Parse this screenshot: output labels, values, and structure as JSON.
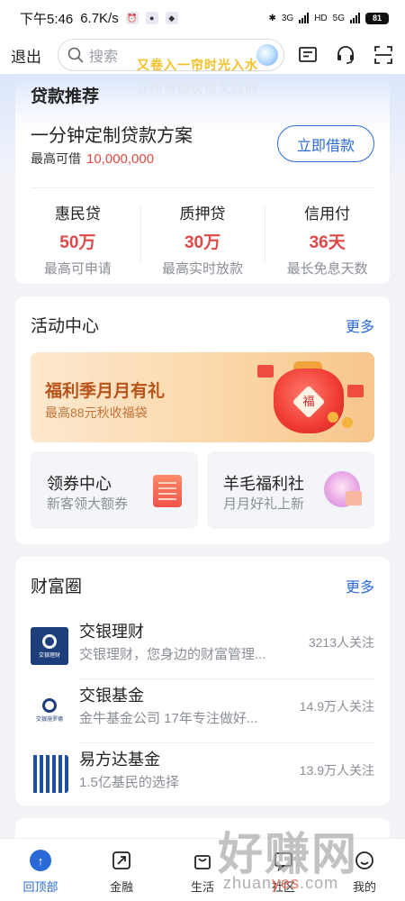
{
  "status_bar": {
    "time": "下午5:46",
    "speed": "6.7K/s",
    "net1": "3G",
    "net2": "5G",
    "hd": "HD",
    "battery": "81"
  },
  "header": {
    "logout": "退出",
    "search_placeholder": "搜索"
  },
  "overlay": {
    "line1": "又卷入一帘时光入水",
    "line2": "让所有很久很久以前"
  },
  "loan": {
    "title": "贷款推荐",
    "headline": "一分钟定制贷款方案",
    "limit_label": "最高可借",
    "limit_value": "10,000,000",
    "button": "立即借款",
    "products": [
      {
        "name": "惠民贷",
        "value": "50万",
        "sub": "最高可申请"
      },
      {
        "name": "质押贷",
        "value": "30万",
        "sub": "最高实时放款"
      },
      {
        "name": "信用付",
        "value": "36天",
        "sub": "最长免息天数"
      }
    ]
  },
  "activity": {
    "title": "活动中心",
    "more": "更多",
    "banner_title": "福利季月月有礼",
    "banner_sub": "最高88元秋收福袋",
    "banner_badge": "福",
    "tiles": [
      {
        "name": "领券中心",
        "desc": "新客领大额券"
      },
      {
        "name": "羊毛福利社",
        "desc": "月月好礼上新"
      }
    ]
  },
  "wealth": {
    "title": "财富圈",
    "more": "更多",
    "funds": [
      {
        "name": "交银理财",
        "desc": "交银理财，您身边的财富管理...",
        "follow": "3213人关注",
        "logo_text": "交银理财"
      },
      {
        "name": "交银基金",
        "desc": "金牛基金公司 17年专注做好...",
        "follow": "14.9万人关注",
        "logo_text": "交银施罗德"
      },
      {
        "name": "易方达基金",
        "desc": "1.5亿基民的选择",
        "follow": "13.9万人关注",
        "logo_text": ""
      }
    ]
  },
  "nav": {
    "items": [
      "回顶部",
      "金融",
      "生活",
      "社区",
      "我的"
    ]
  },
  "watermark": {
    "big": "好赚网",
    "url_a": "zhuan",
    "url_b": "yes",
    "url_c": ".com"
  },
  "colors": {
    "accent": "#2a6ad8",
    "highlight": "#e04848",
    "banner_text": "#b8541a"
  }
}
